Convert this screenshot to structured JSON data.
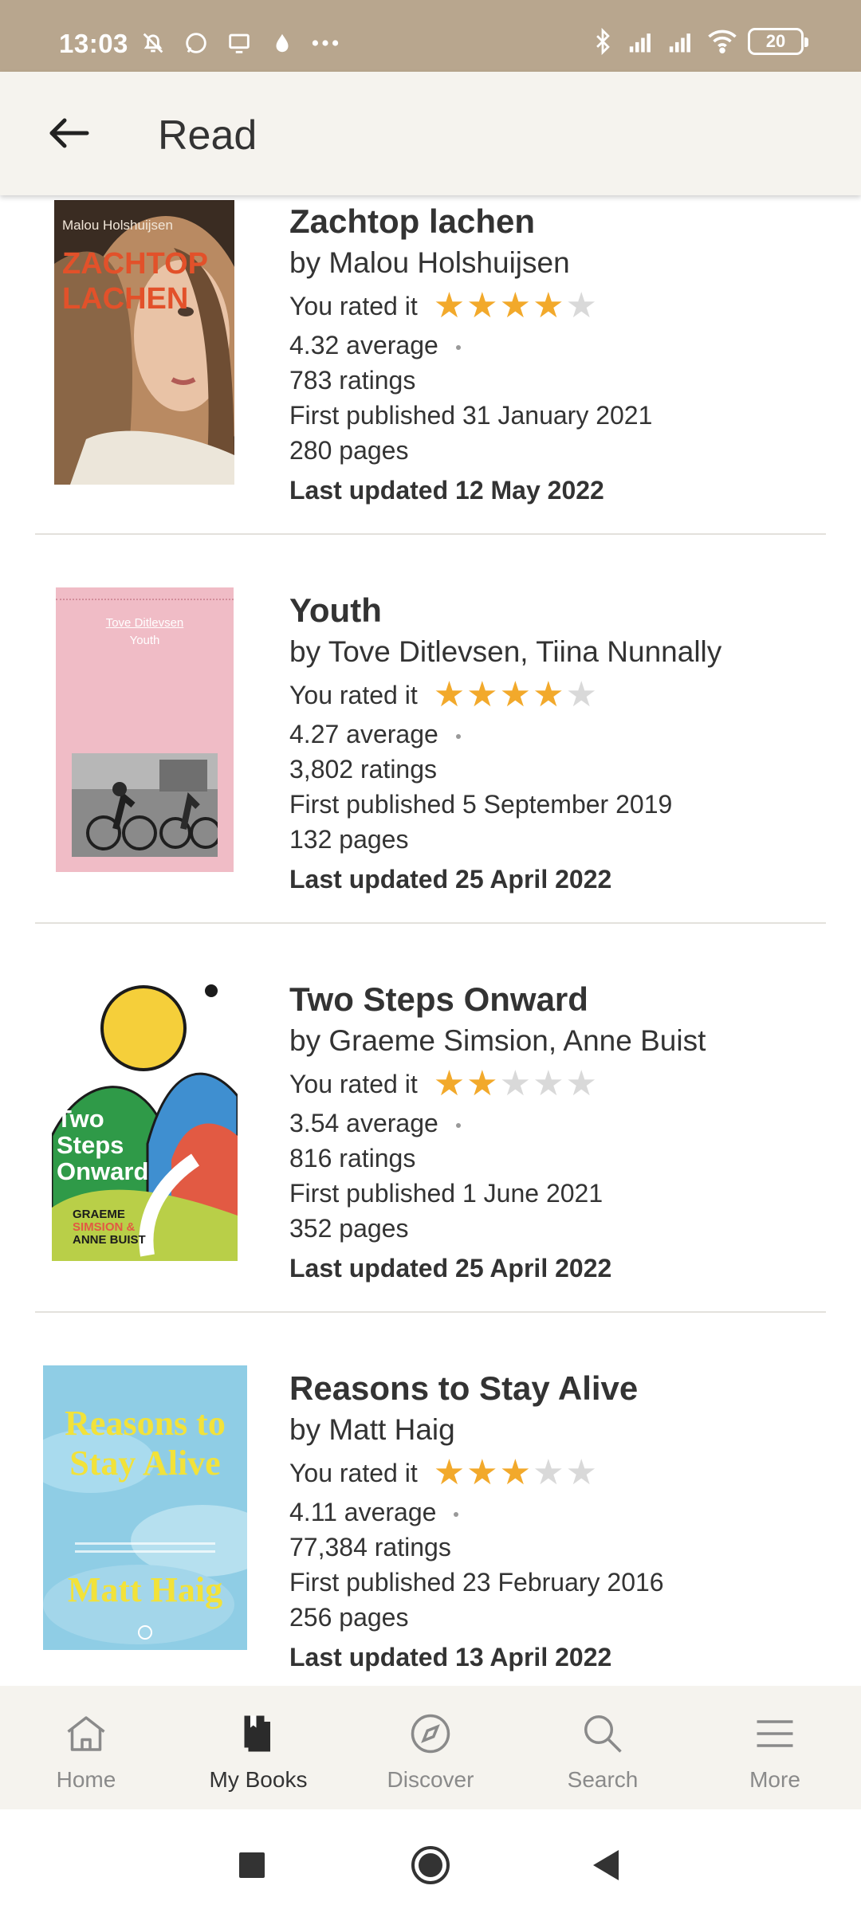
{
  "status_bar": {
    "time": "13:03",
    "battery": "20",
    "left_icons": [
      "bell-off-icon",
      "whatsapp-icon",
      "screen-icon",
      "drop-icon",
      "more-dots-icon"
    ],
    "right_icons": [
      "bluetooth-icon",
      "signal-r-icon",
      "signal-icon",
      "wifi-icon"
    ]
  },
  "app_bar": {
    "title": "Read",
    "back_icon": "arrow-left-icon"
  },
  "books": [
    {
      "title": "Zachtop lachen",
      "author": "by Malou Holshuijsen",
      "rated_label": "You rated it",
      "rating": 4,
      "average": "4.32 average",
      "ratings": "783 ratings",
      "published": "First published 31 January 2021",
      "pages": "280 pages",
      "updated": "Last updated 12 May 2022",
      "cover": {
        "author_text": "Malou Holshuijsen",
        "title_text": "ZACHTOP LACHEN",
        "bg": "#2a2019",
        "accent": "#e2512a"
      }
    },
    {
      "title": "Youth",
      "author": "by Tove Ditlevsen, Tiina Nunnally",
      "rated_label": "You rated it",
      "rating": 4,
      "average": "4.27 average",
      "ratings": "3,802 ratings",
      "published": "First published 5 September 2019",
      "pages": "132 pages",
      "updated": "Last updated 25 April 2022",
      "cover": {
        "author_text": "Tove Ditlevsen",
        "title_text": "Youth",
        "bg": "#f0bcc6"
      }
    },
    {
      "title": "Two Steps Onward",
      "author": "by Graeme Simsion, Anne Buist",
      "rated_label": "You rated it",
      "rating": 2,
      "average": "3.54 average",
      "ratings": "816 ratings",
      "published": "First published 1 June 2021",
      "pages": "352 pages",
      "updated": "Last updated 25 April 2022",
      "cover": {
        "title_text": "Two Steps Onward",
        "author_line1": "GRAEME",
        "author_line2": "SIMSION &",
        "author_line3": "ANNE BUIST",
        "bg": "#ffffff"
      }
    },
    {
      "title": "Reasons to Stay Alive",
      "author": "by Matt Haig",
      "rated_label": "You rated it",
      "rating": 3,
      "average": "4.11 average",
      "ratings": "77,384 ratings",
      "published": "First published 23 February 2016",
      "pages": "256 pages",
      "updated": "Last updated 13 April 2022",
      "cover": {
        "title_text": "Reasons to Stay Alive",
        "author_text": "Matt Haig",
        "bg": "#8ccbe3",
        "accent": "#f2e23a"
      }
    }
  ],
  "bottom_nav": [
    {
      "label": "Home",
      "icon": "home-icon",
      "active": false
    },
    {
      "label": "My Books",
      "icon": "books-icon",
      "active": true
    },
    {
      "label": "Discover",
      "icon": "compass-icon",
      "active": false
    },
    {
      "label": "Search",
      "icon": "search-icon",
      "active": false
    },
    {
      "label": "More",
      "icon": "menu-icon",
      "active": false
    }
  ]
}
